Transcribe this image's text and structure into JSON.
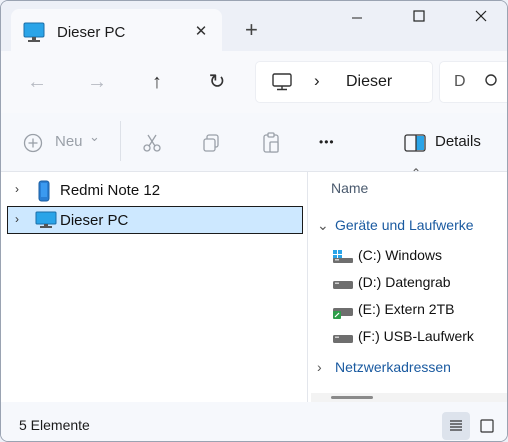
{
  "tab": {
    "title": "Dieser PC",
    "close": "✕",
    "new": "+"
  },
  "window_controls": {
    "minimize": "—",
    "maximize": "☐",
    "close": "✕"
  },
  "nav": {
    "back": "←",
    "forward": "→",
    "up": "↑",
    "refresh": "↻"
  },
  "address": {
    "chevron": "›",
    "location": "Dieser"
  },
  "search": {
    "placeholder": "D"
  },
  "commands": {
    "new": "Neu",
    "new_caret": "⌄",
    "more": "•••",
    "details": "Details"
  },
  "sidebar": {
    "items": [
      {
        "label": "Redmi Note 12",
        "chevron": "›",
        "icon": "phone-icon"
      },
      {
        "label": "Dieser PC",
        "chevron": "›",
        "icon": "monitor-icon",
        "selected": true
      }
    ]
  },
  "list": {
    "column_name": "Name",
    "sort_caret": "⌃",
    "group_devices": "Geräte und Laufwerke",
    "group_devices_chev": "⌄",
    "drives": [
      {
        "label": "(C:) Windows",
        "icon": "windows-drive-icon"
      },
      {
        "label": "(D:) Datengrab",
        "icon": "drive-icon"
      },
      {
        "label": "(E:) Extern 2TB",
        "icon": "external-drive-icon"
      },
      {
        "label": "(F:) USB-Laufwerk",
        "icon": "usb-drive-icon"
      }
    ],
    "group_network": "Netzwerkadressen",
    "group_network_chev": "›"
  },
  "status": {
    "count": "5 Elemente"
  },
  "colors": {
    "accent": "#1a5aa0",
    "selection": "#cde8ff",
    "monitor": "#2aa4e8"
  }
}
